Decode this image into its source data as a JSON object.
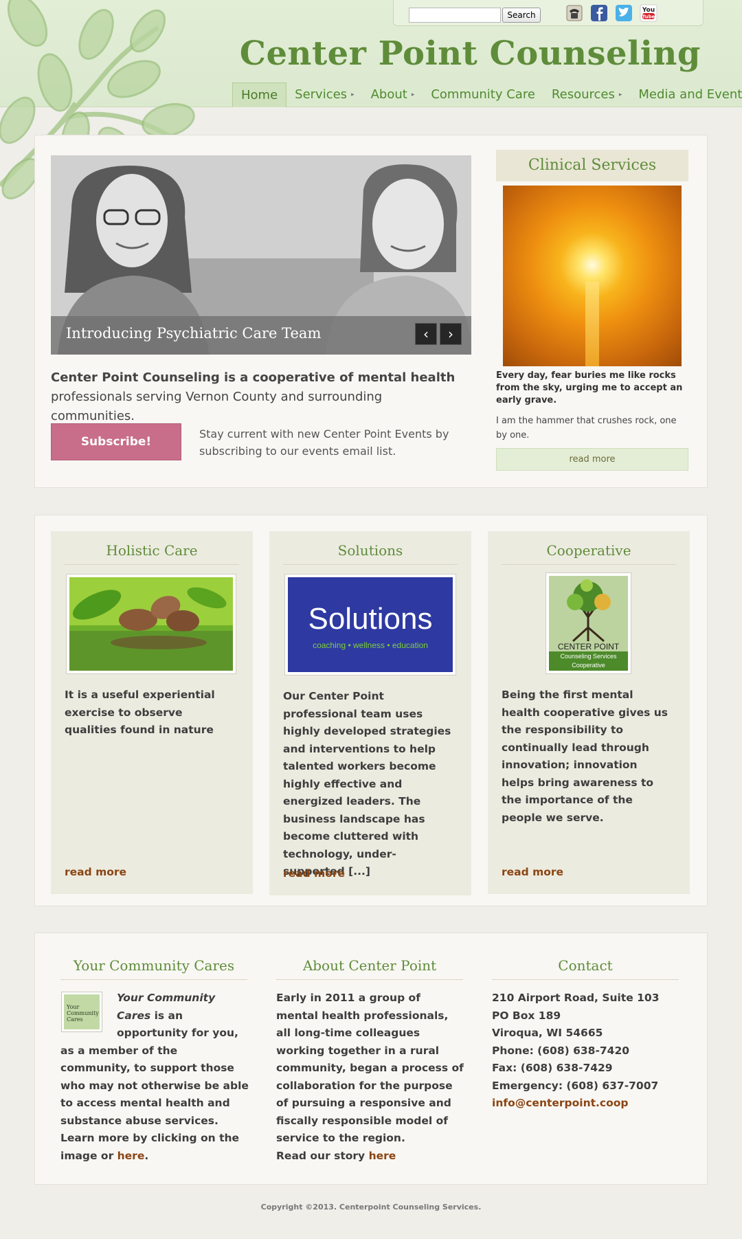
{
  "header": {
    "site_title": "Center Point Counseling",
    "search": {
      "placeholder": "",
      "button_label": "Search"
    },
    "social_icons": [
      "phone-icon",
      "facebook-icon",
      "twitter-icon",
      "youtube-icon"
    ],
    "youtube_text": {
      "top": "You",
      "bottom": "Tube"
    },
    "nav": [
      {
        "label": "Home",
        "active": true
      },
      {
        "label": "Services",
        "has_submenu": true
      },
      {
        "label": "About",
        "has_submenu": true
      },
      {
        "label": "Community Care",
        "has_submenu": false
      },
      {
        "label": "Resources",
        "has_submenu": true
      },
      {
        "label": "Media and Events",
        "has_submenu": false
      }
    ],
    "caret_glyph": "▸"
  },
  "hero": {
    "slide_caption": "Introducing Psychiatric Care Team",
    "prev_glyph": "‹",
    "next_glyph": "›",
    "intro_bold": "Center Point Counseling is a cooperative of mental health",
    "intro_rest": "professionals serving Vernon County and surrounding communities.",
    "subscribe_label": "Subscribe!",
    "subscribe_text": "Stay current with new Center Point Events by subscribing to our events email list."
  },
  "clinical": {
    "title": "Clinical Services",
    "bold_text": "Every day, fear buries me like rocks from the sky, urging me to accept an early grave.",
    "text": "I am the hammer that crushes rock, one by one.",
    "read_more": "read more"
  },
  "features": [
    {
      "title": "Holistic Care",
      "text": "It is a useful experiential exercise to observe qualities found in nature",
      "read_more": "read more"
    },
    {
      "title": "Solutions",
      "logo_word": "Solutions",
      "logo_tagline": "coaching • wellness • education",
      "text": "Our Center Point professional team uses highly developed strategies and interventions to help talented workers become highly effective and energized leaders. The business landscape has become cluttered with technology, under-supported [...]",
      "read_more": "read more"
    },
    {
      "title": "Cooperative",
      "logo_line1": "CENTER POINT",
      "logo_line2": "Counseling Services",
      "logo_line3": "Cooperative",
      "text": "Being the first mental health cooperative gives us the responsibility to continually lead through innovation; innovation helps bring awareness to the importance of the people we serve.",
      "read_more": "read more"
    }
  ],
  "footer": {
    "community": {
      "title": "Your Community Cares",
      "thumb_text": "Your Community Cares",
      "lead_italic": "Your Community Cares",
      "text": " is an opportunity for you, as a member of the community, to support those who may not otherwise be able to access mental health and substance abuse services. Learn more by clicking on the image or ",
      "link": "here",
      "end": "."
    },
    "about": {
      "title": "About Center Point",
      "text": "Early in 2011 a group of mental health professionals, all long-time colleagues working together in a rural community, began a process of collaboration for the purpose of pursuing a responsive and fiscally responsible model of service to the region.",
      "story_prefix": "Read our story ",
      "story_link": "here"
    },
    "contact": {
      "title": "Contact",
      "lines": [
        "210 Airport Road, Suite 103",
        "PO Box 189",
        "Viroqua, WI 54665",
        "Phone: (608) 638-7420",
        "Fax: (608) 638-7429",
        "Emergency: (608) 637-7007"
      ],
      "email": "info@centerpoint.coop"
    }
  },
  "copyright": "Copyright ©2013. Centerpoint Counseling Services.",
  "colors": {
    "accent_green": "#5f8c3a",
    "subscribe_pink": "#c86d8a",
    "link_brown": "#8b4513",
    "panel_beige": "#ecebe0"
  }
}
